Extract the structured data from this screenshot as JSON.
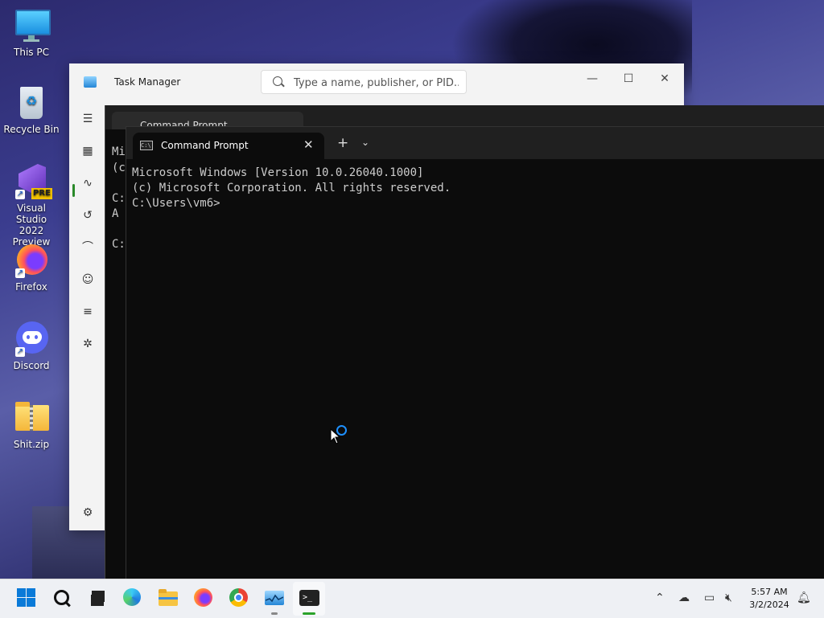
{
  "desktop": {
    "icons": [
      {
        "label": "This PC",
        "icon": "monitor-icon"
      },
      {
        "label": "Recycle Bin",
        "icon": "recycle-bin-icon"
      },
      {
        "label": "Visual Studio 2022 Preview",
        "icon": "visual-studio-icon",
        "badge": "PRE"
      },
      {
        "label": "Firefox",
        "icon": "firefox-icon"
      },
      {
        "label": "Discord",
        "icon": "discord-icon"
      },
      {
        "label": "Shit.zip",
        "icon": "zip-folder-icon"
      }
    ]
  },
  "task_manager": {
    "title": "Task Manager",
    "search_placeholder": "Type a name, publisher, or PID...",
    "minimize": "—",
    "maximize": "☐",
    "close": "✕",
    "nav_icons": [
      "hamburger-menu-icon",
      "processes-icon",
      "performance-icon",
      "app-history-icon",
      "startup-apps-icon",
      "users-icon",
      "details-icon",
      "services-icon",
      "settings-icon"
    ]
  },
  "terminal_back": {
    "tab_title": "Command Prompt",
    "lines": [
      "Mi",
      "(c",
      "",
      "C:",
      "A",
      "",
      "C:"
    ]
  },
  "terminal": {
    "tab_title": "Command Prompt",
    "tab_close": "✕",
    "new_tab": "+",
    "dropdown": "⌄",
    "console_lines": [
      "Microsoft Windows [Version 10.0.26040.1000]",
      "(c) Microsoft Corporation. All rights reserved.",
      "",
      "C:\\Users\\vm6>"
    ]
  },
  "taskbar": {
    "clock_time": "5:57 AM",
    "clock_date": "3/2/2024",
    "apps": [
      "start-icon",
      "search-icon",
      "task-view-icon",
      "edge-icon",
      "file-explorer-icon",
      "firefox-icon",
      "chrome-icon",
      "task-manager-icon",
      "terminal-icon"
    ],
    "tray": [
      "chevron-up-icon",
      "onedrive-icon",
      "network-icon",
      "volume-icon",
      "notification-bell-icon"
    ]
  }
}
